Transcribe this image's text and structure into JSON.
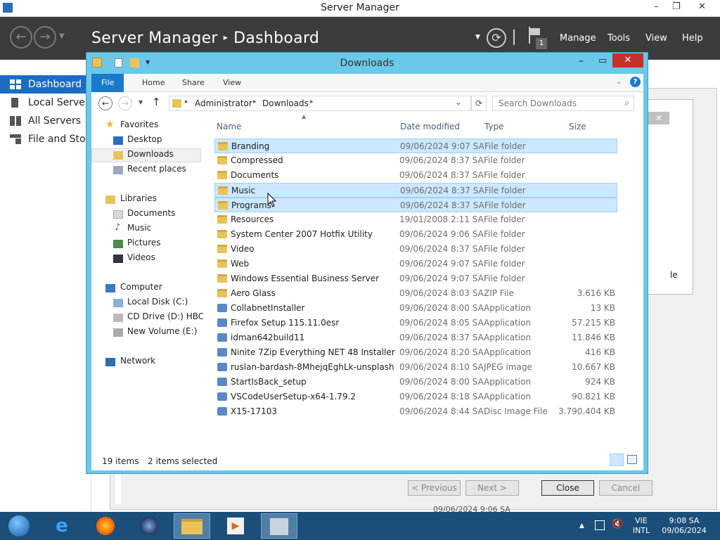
{
  "outer_window": {
    "title": "Server Manager",
    "min": "–",
    "max": "❐",
    "close": "✕"
  },
  "header": {
    "app": "Server Manager",
    "page": "Dashboard",
    "flag_count": "1",
    "menus": [
      "Manage",
      "Tools",
      "View",
      "Help"
    ]
  },
  "nav": {
    "items": [
      "Dashboard",
      "Local Server",
      "All Servers",
      "File and Storage Services"
    ]
  },
  "explorer": {
    "title": "Downloads",
    "ribbon_tabs": [
      "File",
      "Home",
      "Share",
      "View"
    ],
    "breadcrumb": [
      "Administrator",
      "Downloads"
    ],
    "search_placeholder": "Search Downloads",
    "columns": [
      "Name",
      "Date modified",
      "Type",
      "Size"
    ],
    "tree": {
      "favorites": "Favorites",
      "favorites_items": [
        "Desktop",
        "Downloads",
        "Recent places"
      ],
      "libraries": "Libraries",
      "libraries_items": [
        "Documents",
        "Music",
        "Pictures",
        "Videos"
      ],
      "computer": "Computer",
      "computer_items": [
        "Local Disk (C:)",
        "CD Drive (D:) HBCD_",
        "New Volume (E:)"
      ],
      "network": "Network"
    },
    "files": [
      {
        "name": "Branding",
        "date": "09/06/2024 9:07 SA",
        "type": "File folder",
        "size": "",
        "kind": "folder",
        "selected": true
      },
      {
        "name": "Compressed",
        "date": "09/06/2024 8:37 SA",
        "type": "File folder",
        "size": "",
        "kind": "folder",
        "selected": false
      },
      {
        "name": "Documents",
        "date": "09/06/2024 8:37 SA",
        "type": "File folder",
        "size": "",
        "kind": "folder",
        "selected": false
      },
      {
        "name": "Music",
        "date": "09/06/2024 8:37 SA",
        "type": "File folder",
        "size": "",
        "kind": "folder",
        "selected": true
      },
      {
        "name": "Programs",
        "date": "09/06/2024 8:37 SA",
        "type": "File folder",
        "size": "",
        "kind": "folder",
        "selected": true
      },
      {
        "name": "Resources",
        "date": "19/01/2008 2:11 SA",
        "type": "File folder",
        "size": "",
        "kind": "folder",
        "selected": false
      },
      {
        "name": "System Center 2007 Hotfix Utility",
        "date": "09/06/2024 9:06 SA",
        "type": "File folder",
        "size": "",
        "kind": "folder",
        "selected": false
      },
      {
        "name": "Video",
        "date": "09/06/2024 8:37 SA",
        "type": "File folder",
        "size": "",
        "kind": "folder",
        "selected": false
      },
      {
        "name": "Web",
        "date": "09/06/2024 9:07 SA",
        "type": "File folder",
        "size": "",
        "kind": "folder",
        "selected": false
      },
      {
        "name": "Windows Essential Business Server",
        "date": "09/06/2024 9:07 SA",
        "type": "File folder",
        "size": "",
        "kind": "folder",
        "selected": false
      },
      {
        "name": "Aero Glass",
        "date": "09/06/2024 8:03 SA",
        "type": "ZIP File",
        "size": "3.616 KB",
        "kind": "zip",
        "selected": false
      },
      {
        "name": "CollabnetInstaller",
        "date": "09/06/2024 8:00 SA",
        "type": "Application",
        "size": "13 KB",
        "kind": "app",
        "selected": false
      },
      {
        "name": "Firefox Setup 115.11.0esr",
        "date": "09/06/2024 8:05 SA",
        "type": "Application",
        "size": "57.215 KB",
        "kind": "app",
        "selected": false
      },
      {
        "name": "idman642build11",
        "date": "09/06/2024 8:37 SA",
        "type": "Application",
        "size": "11.846 KB",
        "kind": "app",
        "selected": false
      },
      {
        "name": "Ninite 7Zip Everything NET 48 Installer",
        "date": "09/06/2024 8:20 SA",
        "type": "Application",
        "size": "416 KB",
        "kind": "app",
        "selected": false
      },
      {
        "name": "ruslan-bardash-8MhejqEghLk-unsplash",
        "date": "09/06/2024 8:10 SA",
        "type": "JPEG image",
        "size": "10.667 KB",
        "kind": "img",
        "selected": false
      },
      {
        "name": "StartIsBack_setup",
        "date": "09/06/2024 8:00 SA",
        "type": "Application",
        "size": "924 KB",
        "kind": "app",
        "selected": false
      },
      {
        "name": "VSCodeUserSetup-x64-1.79.2",
        "date": "09/06/2024 8:18 SA",
        "type": "Application",
        "size": "90.821 KB",
        "kind": "app",
        "selected": false
      },
      {
        "name": "X15-17103",
        "date": "09/06/2024 8:44 SA",
        "type": "Disc Image File",
        "size": "3.790.404 KB",
        "kind": "iso",
        "selected": false
      }
    ],
    "status_count": "19 items",
    "status_selected": "2 items selected"
  },
  "wizard": {
    "prev": "< Previous",
    "next": "Next >",
    "close": "Close",
    "cancel": "Cancel",
    "timestamp": "09/06/2024 9:06 SA",
    "side_text": "le"
  },
  "taskbar": {
    "lang1": "VIE",
    "lang2": "INTL",
    "time": "9:08 SA",
    "date": "09/06/2024"
  },
  "colors": {
    "accent": "#1c6cc4",
    "selection": "#cce8ff",
    "taskbar": "#1b4f7a",
    "header": "#3c3c3c"
  }
}
